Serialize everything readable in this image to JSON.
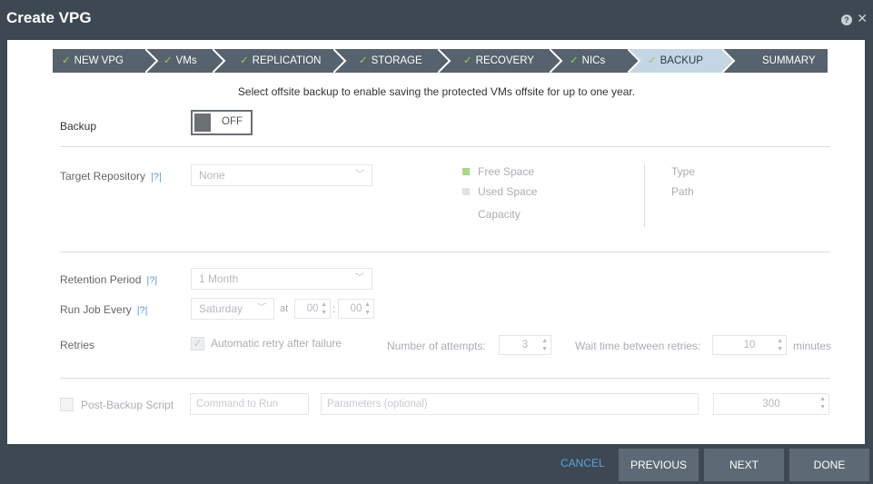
{
  "window": {
    "title": "Create VPG",
    "help_icon": "?",
    "close_icon": "✕"
  },
  "steps": [
    {
      "label": "NEW VPG",
      "done": true
    },
    {
      "label": "VMs",
      "done": true
    },
    {
      "label": "REPLICATION",
      "done": true
    },
    {
      "label": "STORAGE",
      "done": true
    },
    {
      "label": "RECOVERY",
      "done": true
    },
    {
      "label": "NICs",
      "done": true
    },
    {
      "label": "BACKUP",
      "done": true,
      "active": true
    },
    {
      "label": "SUMMARY",
      "done": false
    }
  ],
  "colors": {
    "step_bg": "#56626d",
    "step_active_bg": "#c4d6e3",
    "titlebar": "#3d4853",
    "check": "#8ed14b",
    "link": "#5ba4d8",
    "free_space": "#a8d88a",
    "used_space": "#e0e3e6"
  },
  "intro": "Select offsite backup to enable saving the protected VMs offsite for up to one year.",
  "backup": {
    "label": "Backup",
    "toggle_state": "OFF"
  },
  "target_repository": {
    "label": "Target Repository",
    "help": "|?|",
    "value": "None",
    "free_space": "Free Space",
    "used_space": "Used Space",
    "capacity": "Capacity",
    "type": "Type",
    "path": "Path"
  },
  "retention": {
    "label": "Retention Period",
    "help": "|?|",
    "value": "1 Month"
  },
  "run_job": {
    "label": "Run Job Every",
    "help": "|?|",
    "day": "Saturday",
    "at": "at",
    "hour": "00",
    "sep": ":",
    "minute": "00"
  },
  "retries": {
    "label": "Retries",
    "auto_retry": "Automatic retry after failure",
    "attempts_label": "Number of attempts:",
    "attempts": "3",
    "wait_label": "Wait time between retries:",
    "wait": "10",
    "unit": "minutes"
  },
  "post_backup": {
    "label": "Post-Backup Script",
    "command_placeholder": "Command to Run",
    "params_placeholder": "Parameters (optional)",
    "timeout": "300"
  },
  "footer": {
    "cancel": "CANCEL",
    "previous": "PREVIOUS",
    "next": "NEXT",
    "done": "DONE"
  }
}
